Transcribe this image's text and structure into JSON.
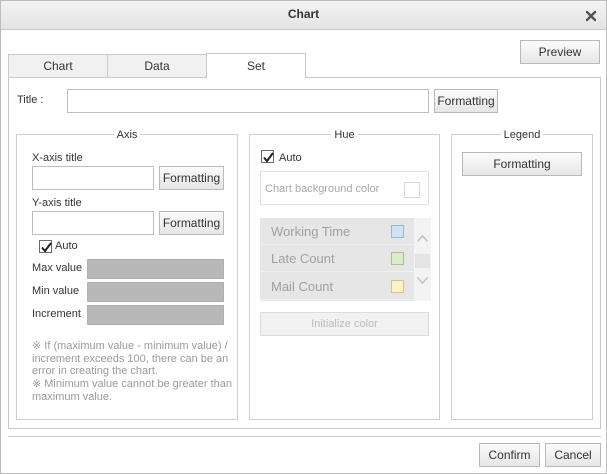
{
  "dialog": {
    "title": "Chart",
    "preview_label": "Preview",
    "confirm_label": "Confirm",
    "cancel_label": "Cancel"
  },
  "tabs": [
    {
      "label": "Chart",
      "active": false
    },
    {
      "label": "Data",
      "active": false
    },
    {
      "label": "Set",
      "active": true
    }
  ],
  "title_row": {
    "label": "Title :",
    "value": "",
    "formatting_label": "Formatting"
  },
  "axis": {
    "heading": "Axis",
    "x_title_label": "X-axis title",
    "x_title_value": "",
    "x_formatting_label": "Formatting",
    "y_title_label": "Y-axis title",
    "y_title_value": "",
    "y_formatting_label": "Formatting",
    "auto_label": "Auto",
    "auto_checked": true,
    "max_label": "Max value",
    "min_label": "Min value",
    "increment_label": "Increment",
    "note_1": "※ If (maximum value - minimum value) / increment exceeds 100, there can be an error in creating the chart.",
    "note_2": "※ Minimum value cannot be greater than maximum value."
  },
  "hue": {
    "heading": "Hue",
    "auto_label": "Auto",
    "auto_checked": true,
    "background_label": "Chart background color",
    "series": [
      {
        "name": "Working Time",
        "color": "#cfe2f6"
      },
      {
        "name": "Late Count",
        "color": "#d9eccb"
      },
      {
        "name": "Mail Count",
        "color": "#fbf2c8"
      }
    ],
    "initialize_label": "Initialize color"
  },
  "legend": {
    "heading": "Legend",
    "formatting_label": "Formatting"
  },
  "colors": {
    "disabled_input": "#b8b8b8",
    "series_background": "#e6e6e6"
  }
}
